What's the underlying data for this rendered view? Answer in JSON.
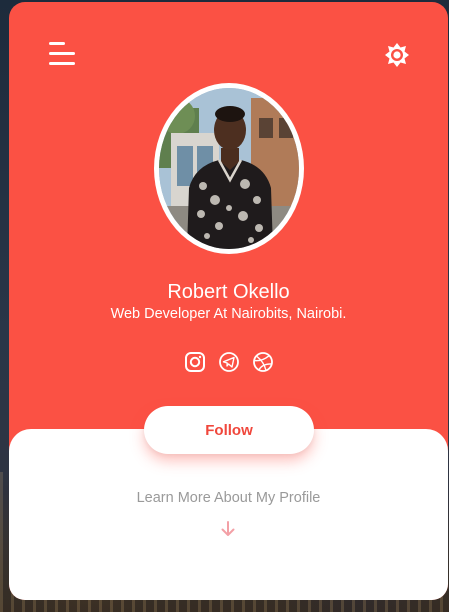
{
  "profile": {
    "name": "Robert Okello",
    "role": "Web Developer At Nairobits, Nairobi."
  },
  "actions": {
    "follow_label": "Follow",
    "learn_more_label": "Learn More About My Profile"
  },
  "icons": {
    "menu": "menu-icon",
    "theme": "brightness-icon",
    "socials": [
      "instagram-icon",
      "telegram-icon",
      "dribbble-icon"
    ],
    "scroll": "arrow-down-icon"
  },
  "colors": {
    "accent": "#fb5144",
    "card_panel": "#ffffff",
    "follow_text": "#f0473c",
    "muted_text": "#9a9a9a",
    "arrow": "#f3a0a6"
  }
}
